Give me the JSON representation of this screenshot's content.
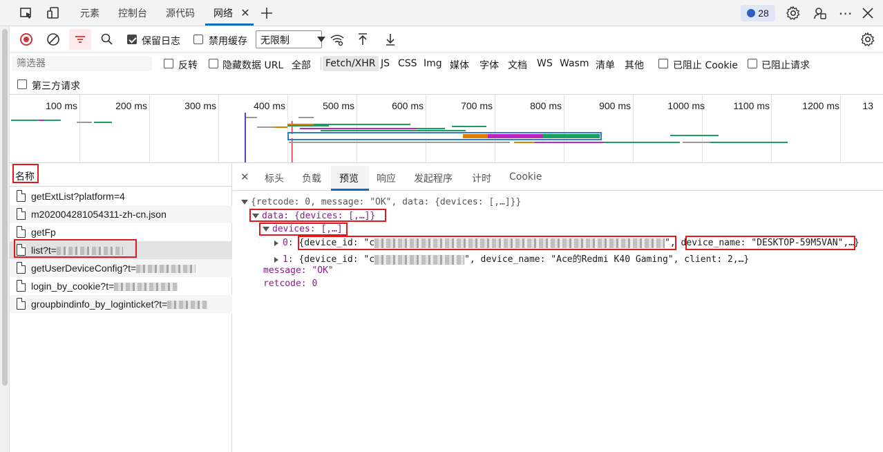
{
  "topbar": {
    "tabs": [
      {
        "label": "元素"
      },
      {
        "label": "控制台"
      },
      {
        "label": "源代码"
      },
      {
        "label": "网络"
      }
    ],
    "issues_count": "28"
  },
  "toolbar": {
    "preserve_log": "保留日志",
    "disable_cache": "禁用缓存",
    "throttle": "无限制"
  },
  "filter": {
    "placeholder": "筛选器",
    "invert": "反转",
    "hide_data_url": "隐藏数据 URL",
    "types": [
      "全部",
      "Fetch/XHR",
      "JS",
      "CSS",
      "Img",
      "媒体",
      "字体",
      "文档",
      "WS",
      "Wasm",
      "清单",
      "其他"
    ],
    "selected_type": "Fetch/XHR",
    "blocked_cookies": "已阻止 Cookie",
    "blocked_requests": "已阻止请求",
    "third_party": "第三方请求"
  },
  "timeline": {
    "ticks": [
      "100 ms",
      "200 ms",
      "300 ms",
      "400 ms",
      "500 ms",
      "600 ms",
      "700 ms",
      "800 ms",
      "900 ms",
      "1000 ms",
      "1100 ms",
      "1200 ms",
      "13"
    ]
  },
  "requests": {
    "header": "名称",
    "items": [
      {
        "name": "getExtList?platform=4"
      },
      {
        "name": "m202004281054311-zh-cn.json"
      },
      {
        "name": "getFp"
      },
      {
        "name": "list?t="
      },
      {
        "name": "getUserDeviceConfig?t="
      },
      {
        "name": "login_by_cookie?t="
      },
      {
        "name": "groupbindinfo_by_loginticket?t="
      }
    ]
  },
  "detail": {
    "tabs": [
      "标头",
      "负载",
      "预览",
      "响应",
      "发起程序",
      "计时",
      "Cookie"
    ],
    "active_tab": "预览",
    "preview": {
      "root": "{retcode: 0, message: \"OK\", data: {devices: [,…]}}",
      "data_line": "data: {devices: [,…]}",
      "devices_line": "devices: [,…]",
      "item0_index": "0:",
      "item0_id": "{device_id: \"c",
      "item0_name": "device_name: \"DESKTOP-59M5VAN\"",
      "item0_tail": ",…}",
      "item1_index": "1:",
      "item1_id": "{device_id: \"c",
      "item1_rest": "\", device_name: \"Ace的Redmi K40 Gaming\", client: 2,…}",
      "message_line": "message: \"OK\"",
      "retcode_line": "retcode: 0"
    }
  },
  "colors": {
    "accent": "#0f6cbd",
    "record": "#d13438",
    "highlight_box": "#e0181c"
  }
}
